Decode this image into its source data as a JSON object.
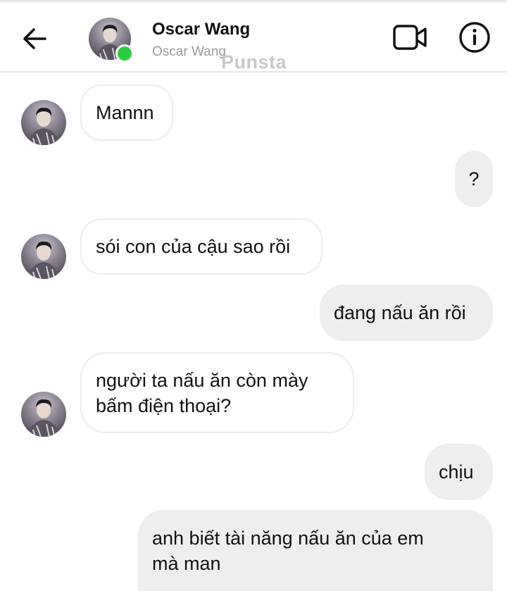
{
  "header": {
    "back_icon": "arrow-left-icon",
    "contact_name": "Oscar Wang",
    "contact_username": "Oscar Wang",
    "online_status_color": "#2ecc40",
    "watermark": "Punsta",
    "video_icon": "video-camera-icon",
    "info_icon": "info-circle-icon"
  },
  "messages": [
    {
      "sender": "Oscar Wang",
      "direction": "incoming",
      "text": "Mannn"
    },
    {
      "sender": "me",
      "direction": "outgoing",
      "text": "?"
    },
    {
      "sender": "Oscar Wang",
      "direction": "incoming",
      "text": "sói con của cậu sao rồi"
    },
    {
      "sender": "me",
      "direction": "outgoing",
      "text": "đang nấu ăn rồi"
    },
    {
      "sender": "Oscar Wang",
      "direction": "incoming",
      "text": "người ta nấu ăn còn mày\nbấm điện thoại?"
    },
    {
      "sender": "me",
      "direction": "outgoing",
      "text": "chịu"
    },
    {
      "sender": "me",
      "direction": "outgoing",
      "text": "anh biết tài năng nấu ăn của em\nmà man"
    }
  ],
  "colors": {
    "incoming_bubble_bg": "#ffffff",
    "incoming_bubble_border": "#ececec",
    "outgoing_bubble_bg": "#eeeeee",
    "text": "#111111",
    "muted_text": "#9a9a9a"
  }
}
